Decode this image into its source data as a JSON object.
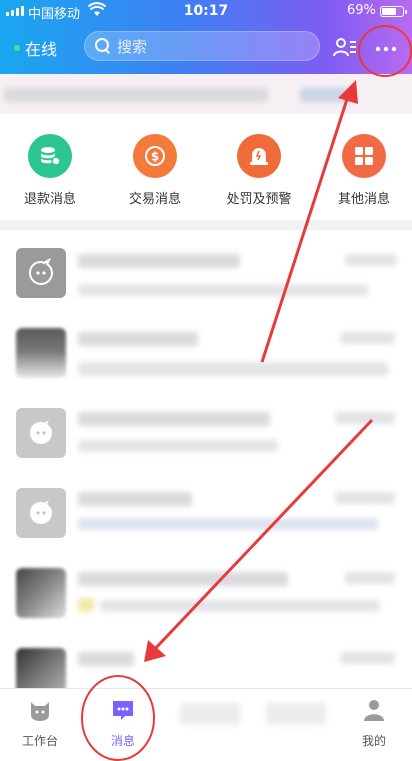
{
  "status_bar": {
    "carrier": "中国移动",
    "time": "10:17",
    "battery_percent": "69%",
    "battery_level": 0.69
  },
  "header": {
    "status_label": "在线",
    "search_placeholder": "搜索"
  },
  "categories": [
    {
      "label": "退款消息",
      "color": "#2bc58f",
      "icon": "refund-icon"
    },
    {
      "label": "交易消息",
      "color": "#f37a3a",
      "icon": "trade-icon"
    },
    {
      "label": "处罚及预警",
      "color": "#f06a3a",
      "icon": "warning-icon"
    },
    {
      "label": "其他消息",
      "color": "#f26a45",
      "icon": "grid-icon"
    }
  ],
  "tabbar": {
    "items": [
      {
        "label": "工作台",
        "icon": "workbench-icon"
      },
      {
        "label": "消息",
        "icon": "message-icon"
      },
      {
        "label": "我的",
        "icon": "profile-icon"
      }
    ],
    "active_color": "#7b61ff"
  },
  "annotation_color": "#e83a3a"
}
